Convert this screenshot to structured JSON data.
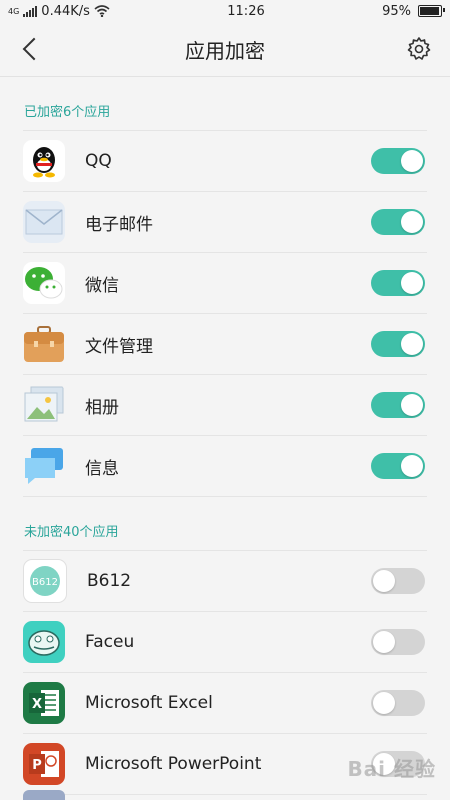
{
  "status_bar": {
    "net": "4G",
    "speed": "0.44K/s",
    "time": "11:26",
    "battery": "95%"
  },
  "header": {
    "title": "应用加密"
  },
  "encrypted": {
    "title": "已加密6个应用",
    "apps": [
      {
        "name": "QQ",
        "icon": "qq-icon",
        "on": true
      },
      {
        "name": "电子邮件",
        "icon": "email-icon",
        "on": true
      },
      {
        "name": "微信",
        "icon": "wechat-icon",
        "on": true
      },
      {
        "name": "文件管理",
        "icon": "briefcase-icon",
        "on": true
      },
      {
        "name": "相册",
        "icon": "photo-icon",
        "on": true
      },
      {
        "name": "信息",
        "icon": "message-icon",
        "on": true
      }
    ]
  },
  "unencrypted": {
    "title": "未加密40个应用",
    "apps": [
      {
        "name": "B612",
        "icon": "b612-icon",
        "on": false
      },
      {
        "name": "Faceu",
        "icon": "faceu-icon",
        "on": false
      },
      {
        "name": "Microsoft Excel",
        "icon": "excel-icon",
        "on": false
      },
      {
        "name": "Microsoft PowerPoint",
        "icon": "powerpoint-icon",
        "on": false
      }
    ]
  },
  "watermark": "Bai 经验",
  "colors": {
    "accent": "#3fbfa8",
    "section": "#2aa59a",
    "toggle_off": "#d4d4d4"
  }
}
